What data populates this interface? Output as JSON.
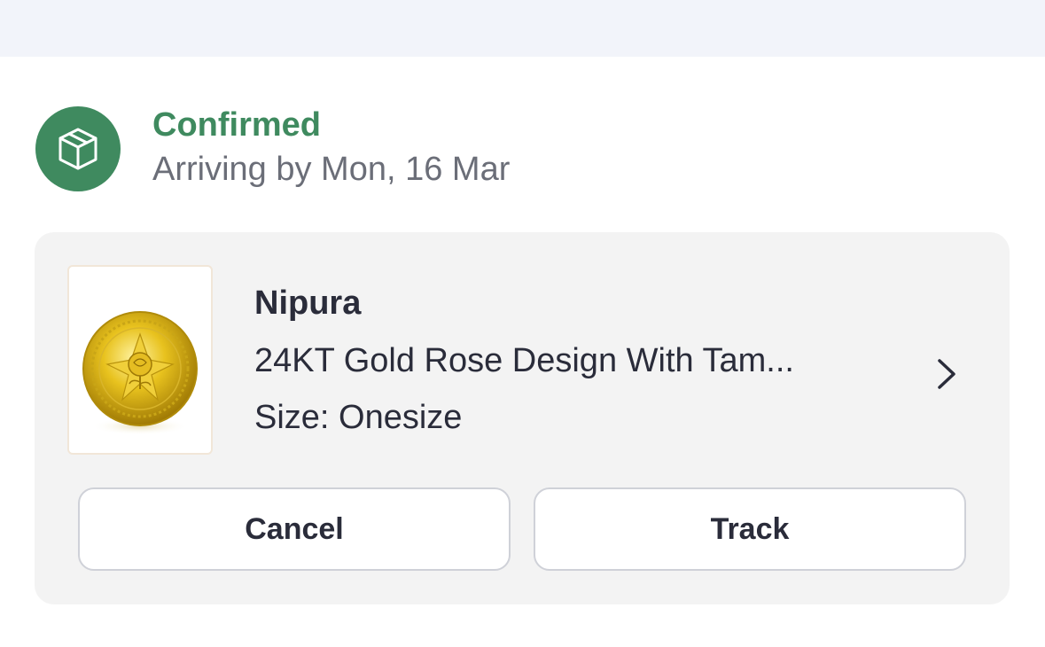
{
  "order_status": {
    "icon": "package-box-icon",
    "title": "Confirmed",
    "subtitle": "Arriving by Mon, 16 Mar",
    "accent_color": "#3f8a5f"
  },
  "product": {
    "image": "gold-coin-rose-image",
    "brand": "Nipura",
    "name": "24KT Gold Rose Design With Tam...",
    "size": "Size: Onesize",
    "chevron_icon": "chevron-right-icon"
  },
  "actions": {
    "cancel_label": "Cancel",
    "track_label": "Track"
  }
}
